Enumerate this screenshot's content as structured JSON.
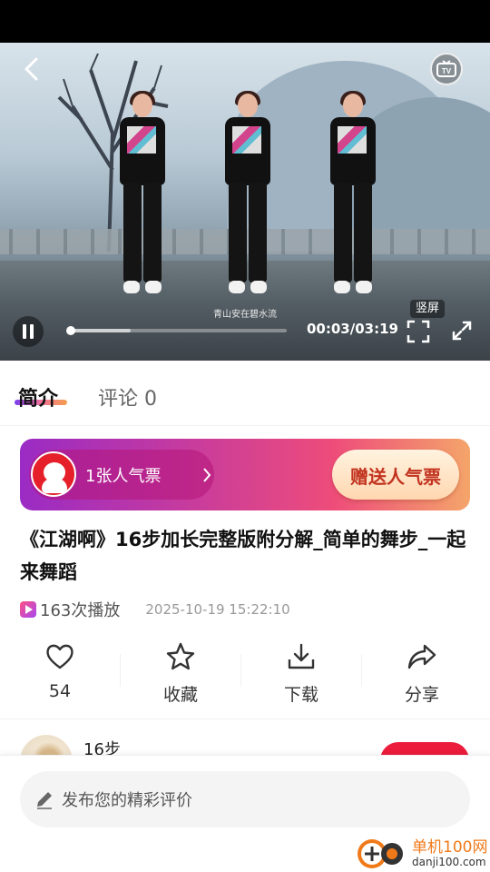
{
  "video": {
    "caption": "青山安在碧水流",
    "portrait_label": "竖屏",
    "time": "00:03/03:19",
    "progress_fraction": 0.016,
    "buffer_fraction": 0.29
  },
  "tabs": [
    {
      "label": "简介",
      "active": true
    },
    {
      "label": "评论 0",
      "active": false
    }
  ],
  "promo": {
    "ticket_text": "1张人气票",
    "gift_button": "赠送人气票"
  },
  "title": "《江湖啊》16步加长完整版附分解_简单的舞步_一起来舞蹈",
  "meta": {
    "play_count": "163次播放",
    "publish_time": "2025-10-19 15:22:10"
  },
  "actions": [
    {
      "icon": "heart-icon",
      "label": "54"
    },
    {
      "icon": "star-icon",
      "label": "收藏"
    },
    {
      "icon": "download-icon",
      "label": "下载"
    },
    {
      "icon": "share-icon",
      "label": "分享"
    }
  ],
  "author": {
    "name": "16步"
  },
  "comment_bar": {
    "placeholder": "发布您的精彩评价"
  },
  "watermark": {
    "name": "单机100网",
    "url": "danji100.com"
  },
  "colors": {
    "accent_red": "#ec1c3c",
    "promo_start": "#9a2bc4",
    "promo_end": "#f4a56a",
    "watermark_orange": "#f07a1a"
  }
}
